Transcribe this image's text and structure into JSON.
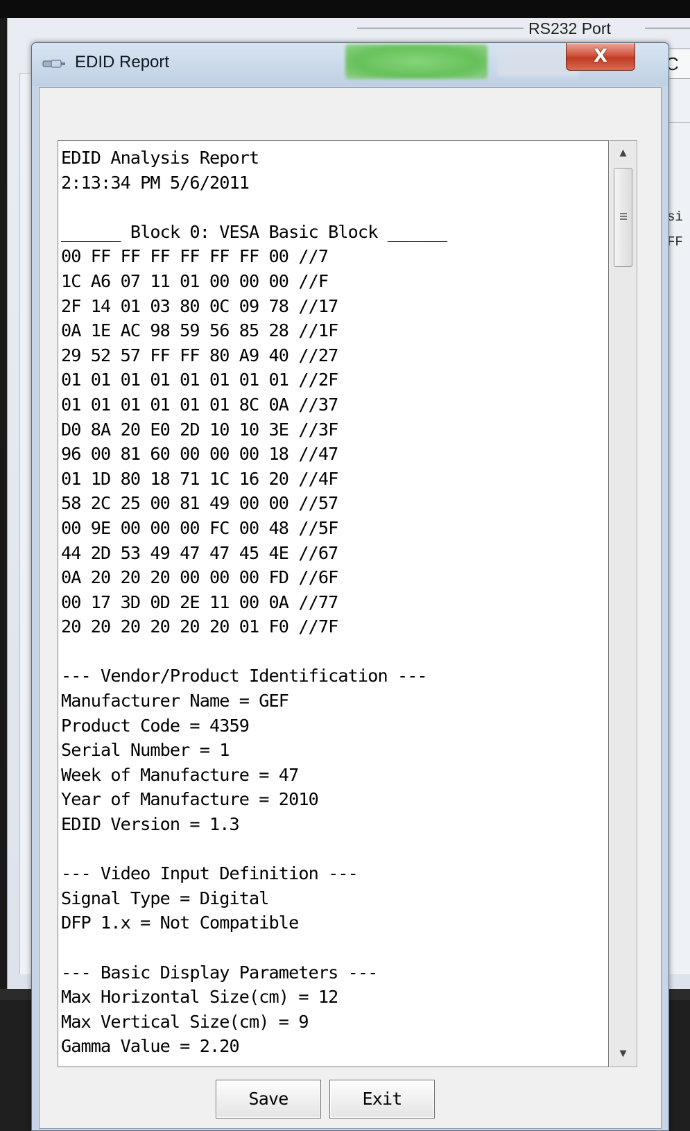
{
  "background": {
    "group_label": "RS232 Port",
    "side_box_text": "C",
    "partial_text": [
      "si",
      "FF"
    ]
  },
  "dialog": {
    "title": "EDID Report",
    "close_glyph": "X",
    "icon": "connector-icon"
  },
  "report": {
    "lines": [
      "EDID Analysis Report",
      "2:13:34 PM 5/6/2011",
      "",
      "______ Block 0: VESA Basic Block ______",
      "00 FF FF FF FF FF FF 00 //7",
      "1C A6 07 11 01 00 00 00 //F",
      "2F 14 01 03 80 0C 09 78 //17",
      "0A 1E AC 98 59 56 85 28 //1F",
      "29 52 57 FF FF 80 A9 40 //27",
      "01 01 01 01 01 01 01 01 //2F",
      "01 01 01 01 01 01 8C 0A //37",
      "D0 8A 20 E0 2D 10 10 3E //3F",
      "96 00 81 60 00 00 00 18 //47",
      "01 1D 80 18 71 1C 16 20 //4F",
      "58 2C 25 00 81 49 00 00 //57",
      "00 9E 00 00 00 FC 00 48 //5F",
      "44 2D 53 49 47 47 45 4E //67",
      "0A 20 20 20 00 00 00 FD //6F",
      "00 17 3D 0D 2E 11 00 0A //77",
      "20 20 20 20 20 20 01 F0 //7F",
      "",
      "--- Vendor/Product Identification ---",
      "Manufacturer Name = GEF",
      "Product Code = 4359",
      "Serial Number = 1",
      "Week of Manufacture = 47",
      "Year of Manufacture = 2010",
      "EDID Version = 1.3",
      "",
      "--- Video Input Definition ---",
      "Signal Type = Digital",
      "DFP 1.x = Not Compatible",
      "",
      "--- Basic Display Parameters ---",
      "Max Horizontal Size(cm) = 12",
      "Max Vertical Size(cm) = 9",
      "Gamma Value = 2.20"
    ]
  },
  "scrollbar": {
    "up_glyph": "▲",
    "down_glyph": "▼",
    "position": 0.0
  },
  "buttons": {
    "save_label": "Save",
    "exit_label": "Exit"
  }
}
